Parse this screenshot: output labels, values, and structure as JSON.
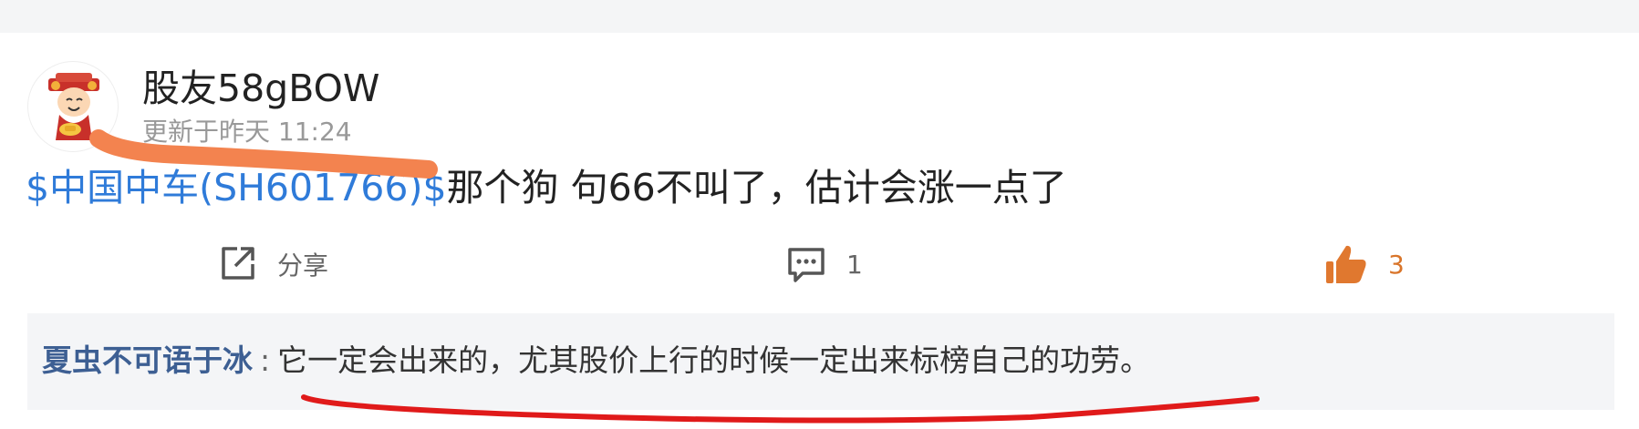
{
  "post": {
    "author": "股友58gBOW",
    "time": "更新于昨天 11:24",
    "stock_tag": "$中国中车(SH601766)$",
    "text": "那个狗 句66不叫了，估计会涨一点了"
  },
  "actions": {
    "share_label": "分享",
    "comment_count": "1",
    "like_count": "3"
  },
  "comment": {
    "author": "夏虫不可语于冰",
    "separator": ":",
    "text": "它一定会出来的，尤其股价上行的时候一定出来标榜自己的功劳。"
  },
  "icons": {
    "avatar": "cartoon-god-of-wealth-avatar",
    "share": "share-external-icon",
    "comment": "comment-bubble-icon",
    "like": "thumbs-up-icon"
  },
  "colors": {
    "link_blue": "#2f7bd9",
    "like_orange": "#e0782f",
    "commenter_blue": "#3d5f93",
    "annotation_orange": "#f3834f",
    "annotation_red": "#e01a1a"
  }
}
